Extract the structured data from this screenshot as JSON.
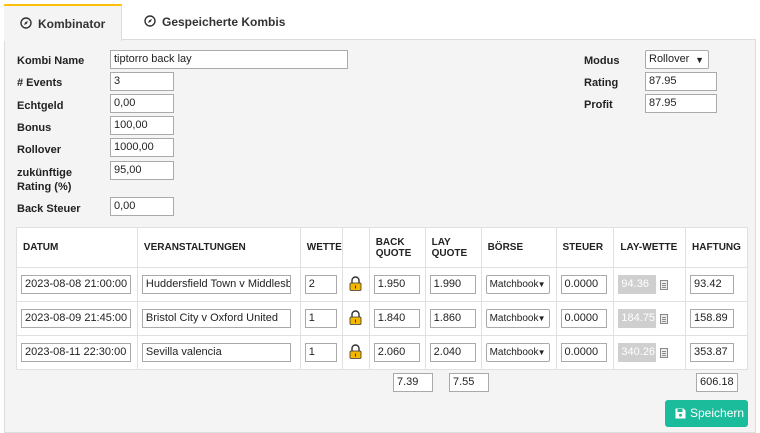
{
  "tabs": [
    {
      "label": "Kombinator",
      "icon": "compass-icon"
    },
    {
      "label": "Gespeicherte Kombis",
      "icon": "compass-icon"
    }
  ],
  "form": {
    "kombi_name_label": "Kombi Name",
    "kombi_name_value": "tiptorro back lay",
    "events_label": "# Events",
    "events_value": "3",
    "echtgeld_label": "Echtgeld",
    "echtgeld_value": "0,00",
    "bonus_label": "Bonus",
    "bonus_value": "100,00",
    "rollover_label": "Rollover",
    "rollover_value": "1000,00",
    "future_rating_label_1": "zukünftige",
    "future_rating_label_2": "Rating (%)",
    "future_rating_value": "95,00",
    "back_steuer_label": "Back Steuer",
    "back_steuer_value": "0,00"
  },
  "side": {
    "modus_label": "Modus",
    "modus_value": "Rollover",
    "rating_label": "Rating",
    "rating_value": "87.95",
    "profit_label": "Profit",
    "profit_value": "87.95"
  },
  "table": {
    "headers": {
      "datum": "DATUM",
      "veranstaltungen": "VERANSTALTUNGEN",
      "wette": "WETTE",
      "back_quote_1": "BACK",
      "back_quote_2": "QUOTE",
      "lay_quote_1": "LAY",
      "lay_quote_2": "QUOTE",
      "boerse": "BÖRSE",
      "steuer": "STEUER",
      "lay_wette": "LAY-WETTE",
      "haftung": "HAFTUNG"
    },
    "rows": [
      {
        "datum": "2023-08-08 21:00:00",
        "event": "Huddersfield Town v Middlesbro",
        "wette": "2",
        "back": "1.950",
        "lay": "1.990",
        "boerse": "Matchbook",
        "steuer": "0.0000",
        "lay_wette": "94.36",
        "haftung": "93.42"
      },
      {
        "datum": "2023-08-09 21:45:00",
        "event": "Bristol City v Oxford United",
        "wette": "1",
        "back": "1.840",
        "lay": "1.860",
        "boerse": "Matchbook",
        "steuer": "0.0000",
        "lay_wette": "184.75",
        "haftung": "158.89"
      },
      {
        "datum": "2023-08-11 22:30:00",
        "event": "Sevilla valencia",
        "wette": "1",
        "back": "2.060",
        "lay": "2.040",
        "boerse": "Matchbook",
        "steuer": "0.0000",
        "lay_wette": "340.26",
        "haftung": "353.87"
      }
    ],
    "totals": {
      "back": "7.39",
      "lay": "7.55",
      "haftung": "606.18"
    }
  },
  "save_button": {
    "label": "Speichern",
    "icon": "floppy-disk-icon"
  },
  "colors": {
    "accent": "#ffc107",
    "save": "#1abc9c",
    "lock": "#f5b800"
  }
}
